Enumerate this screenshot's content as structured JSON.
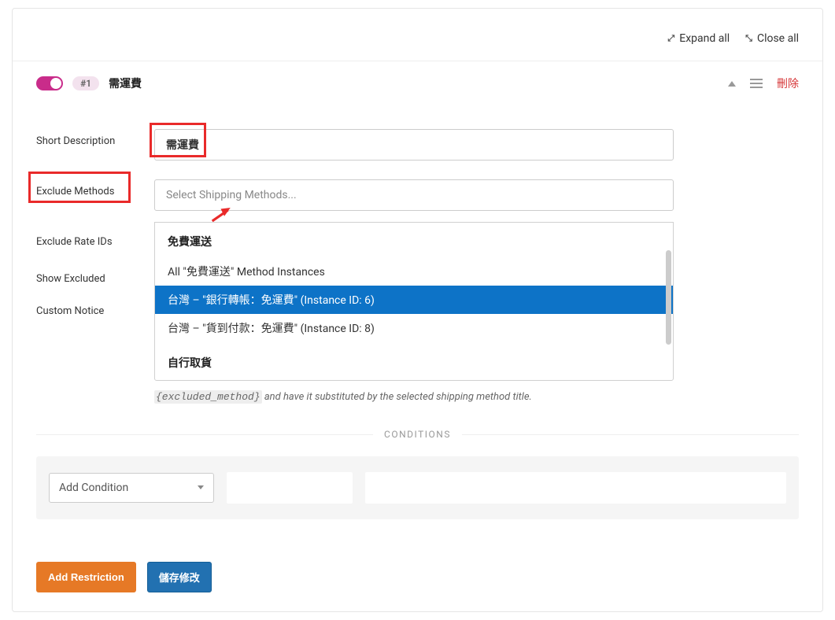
{
  "top_actions": {
    "expand_all": "Expand all",
    "close_all": "Close all"
  },
  "restriction": {
    "badge": "#1",
    "title": "需運費",
    "delete": "刪除"
  },
  "fields": {
    "short_description": {
      "label": "Short Description",
      "value": "需運費"
    },
    "exclude_methods": {
      "label": "Exclude Methods",
      "placeholder": "Select Shipping Methods..."
    },
    "exclude_rate_ids": {
      "label": "Exclude Rate IDs"
    },
    "show_excluded": {
      "label": "Show Excluded"
    },
    "custom_notice": {
      "label": "Custom Notice"
    }
  },
  "dropdown": {
    "group1": "免費運送",
    "items": [
      "All \"免費運送\" Method Instances",
      "台灣 – \"銀行轉帳：免運費\" (Instance ID: 6)",
      "台灣 – \"貨到付款：免運費\" (Instance ID: 8)"
    ],
    "group2": "自行取貨",
    "highlighted_index": 1
  },
  "helper": {
    "code": "{excluded_method}",
    "text": " and have it substituted by the selected shipping method title."
  },
  "conditions": {
    "label": "CONDITIONS",
    "add_condition": "Add Condition"
  },
  "buttons": {
    "add_restriction": "Add Restriction",
    "save": "儲存修改"
  }
}
